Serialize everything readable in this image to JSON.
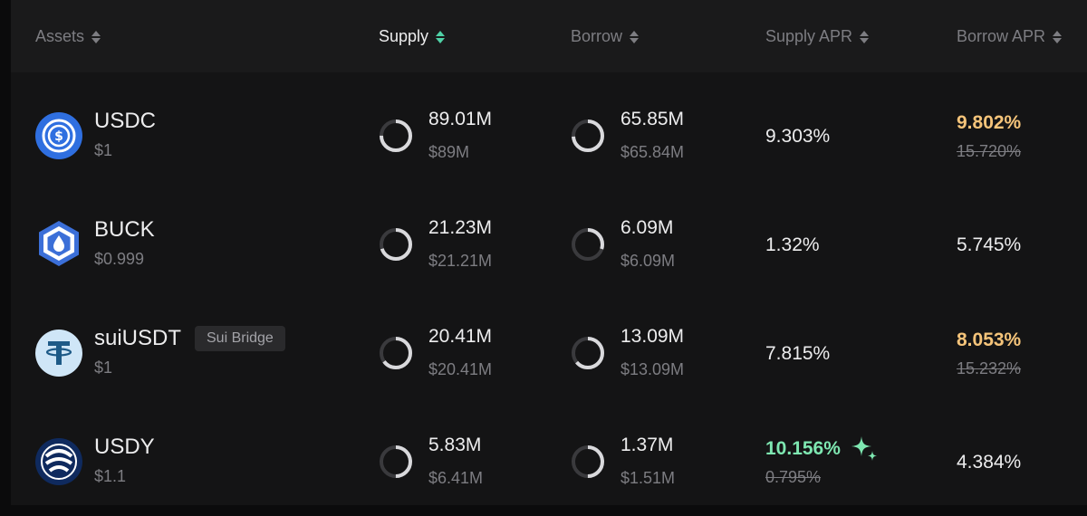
{
  "header": {
    "assets_label": "Assets",
    "supply_label": "Supply",
    "borrow_label": "Borrow",
    "supply_apr_label": "Supply APR",
    "borrow_apr_label": "Borrow APR"
  },
  "colors": {
    "accent_sort": "#4fd1a6",
    "boosted_orange": "#f5c47a",
    "boosted_green": "#7ee7b1"
  },
  "rows": [
    {
      "symbol": "USDC",
      "price": "$1",
      "icon": "usdc-icon",
      "supply": "89.01M",
      "supply_usd": "$89M",
      "supply_util": 0.75,
      "borrow": "65.85M",
      "borrow_usd": "$65.84M",
      "borrow_util": 0.74,
      "supply_apr": "9.303%",
      "borrow_apr": "9.802%",
      "borrow_apr_original": "15.720%"
    },
    {
      "symbol": "BUCK",
      "price": "$0.999",
      "icon": "buck-icon",
      "supply": "21.23M",
      "supply_usd": "$21.21M",
      "supply_util": 0.7,
      "borrow": "6.09M",
      "borrow_usd": "$6.09M",
      "borrow_util": 0.3,
      "supply_apr": "1.32%",
      "borrow_apr": "5.745%"
    },
    {
      "symbol": "suiUSDT",
      "price": "$1",
      "icon": "tether-icon",
      "badge": "Sui Bridge",
      "supply": "20.41M",
      "supply_usd": "$20.41M",
      "supply_util": 0.65,
      "borrow": "13.09M",
      "borrow_usd": "$13.09M",
      "borrow_util": 0.64,
      "supply_apr": "7.815%",
      "borrow_apr": "8.053%",
      "borrow_apr_original": "15.232%"
    },
    {
      "symbol": "USDY",
      "price": "$1.1",
      "icon": "usdy-icon",
      "supply": "5.83M",
      "supply_usd": "$6.41M",
      "supply_util": 0.5,
      "borrow": "1.37M",
      "borrow_usd": "$1.51M",
      "borrow_util": 0.5,
      "supply_apr": "10.156%",
      "supply_apr_original": "0.795%",
      "borrow_apr": "4.384%"
    }
  ]
}
